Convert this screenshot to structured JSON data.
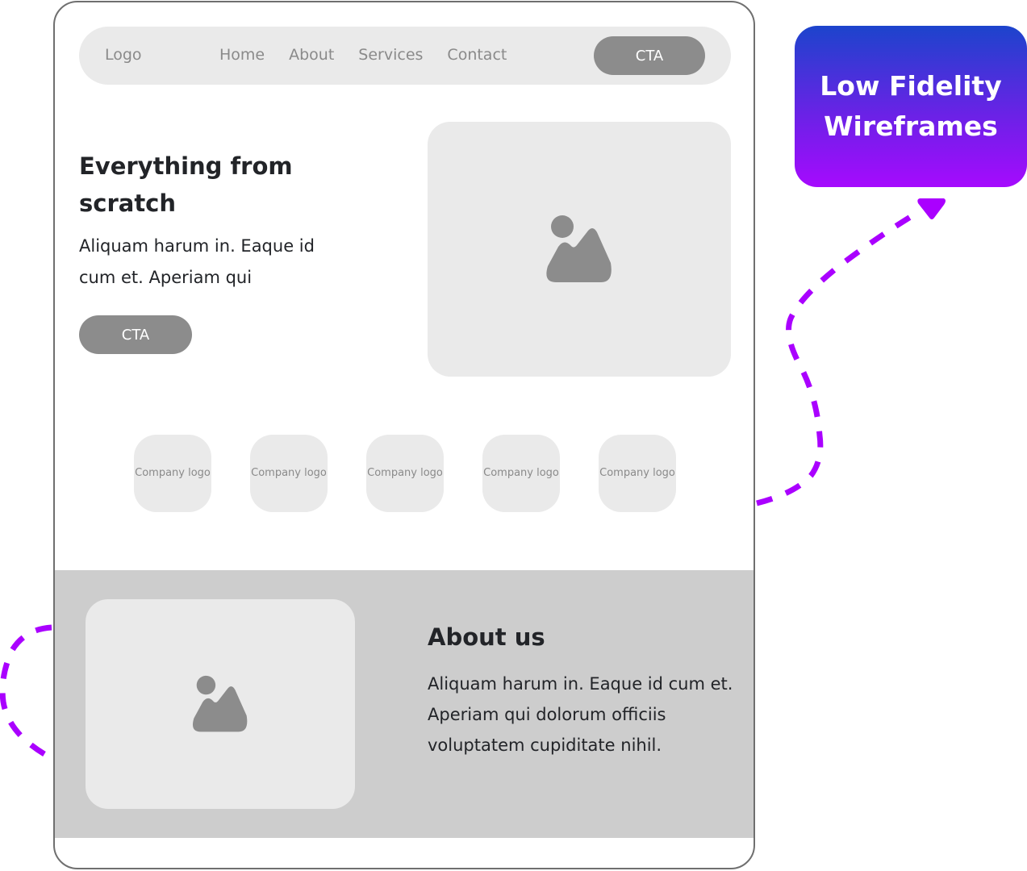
{
  "navbar": {
    "logo": "Logo",
    "links": [
      "Home",
      "About",
      "Services",
      "Contact"
    ],
    "cta_label": "CTA"
  },
  "hero": {
    "title": "Everything from scratch",
    "text": "Aliquam harum in. Eaque id cum et. Aperiam qui",
    "cta_label": "CTA",
    "image_icon": "image-placeholder-icon"
  },
  "logos": [
    {
      "label": "Company logo"
    },
    {
      "label": "Company logo"
    },
    {
      "label": "Company logo"
    },
    {
      "label": "Company logo"
    },
    {
      "label": "Company logo"
    }
  ],
  "about": {
    "title": "About us",
    "text": "Aliquam harum in. Eaque id cum et. Aperiam qui dolorum officiis voluptatem cupiditate nihil.",
    "image_icon": "image-placeholder-icon"
  },
  "badge": {
    "line1": "Low Fidelity",
    "line2": "Wireframes",
    "gradient_top": "#1c44cc",
    "gradient_bottom": "#a60afe"
  },
  "colors": {
    "accent_dashed": "#aa00ff",
    "placeholder_fill": "#eaeaea",
    "button_fill": "#8c8c8c",
    "section_bg": "#cdcdcd",
    "text_dark": "#222428"
  }
}
